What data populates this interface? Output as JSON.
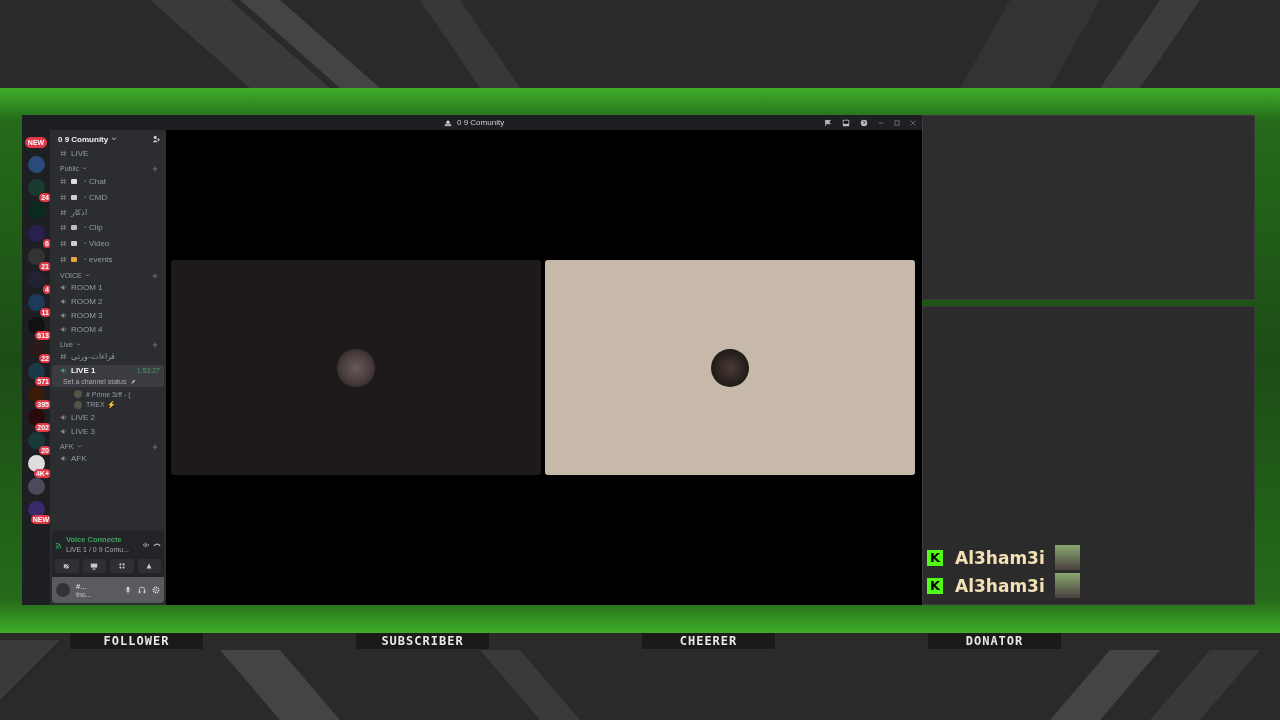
{
  "window": {
    "title": "0 9 Comunity"
  },
  "server_rail": [
    {
      "kind": "pill",
      "badge": "NEW"
    },
    {
      "kind": "server"
    },
    {
      "kind": "server",
      "badge": "24"
    },
    {
      "kind": "server"
    },
    {
      "kind": "server",
      "badge": "6"
    },
    {
      "kind": "server",
      "badge": "21"
    },
    {
      "kind": "server",
      "badge": "4"
    },
    {
      "kind": "server",
      "badge": "11"
    },
    {
      "kind": "server",
      "badge": "613"
    },
    {
      "kind": "server",
      "badge": "22"
    },
    {
      "kind": "server",
      "badge": "571"
    },
    {
      "kind": "server",
      "badge": "395"
    },
    {
      "kind": "server",
      "badge": "202"
    },
    {
      "kind": "server",
      "badge": "20"
    },
    {
      "kind": "server",
      "badge": "4K+"
    },
    {
      "kind": "server"
    },
    {
      "kind": "server",
      "badge": "NEW"
    }
  ],
  "server": {
    "name": "0 9 Comunity"
  },
  "top_channel": "LIVE",
  "categories": [
    {
      "name": "Public",
      "channels": [
        {
          "kind": "text",
          "name": "・Chat",
          "selected": false
        },
        {
          "kind": "text",
          "name": "・CMD",
          "selected": false
        },
        {
          "kind": "text",
          "name": "اذكار",
          "selected": false
        },
        {
          "kind": "text",
          "name": "・Clip",
          "selected": false
        },
        {
          "kind": "text",
          "name": "・Video",
          "selected": false
        },
        {
          "kind": "text",
          "name": "・events",
          "selected": false
        }
      ]
    },
    {
      "name": "VOICE",
      "channels": [
        {
          "kind": "voice",
          "name": "ROOM 1",
          "selected": false
        },
        {
          "kind": "voice",
          "name": "ROOM 2",
          "selected": false
        },
        {
          "kind": "voice",
          "name": "ROOM 3",
          "selected": false
        },
        {
          "kind": "voice",
          "name": "ROOM 4",
          "selected": false
        }
      ]
    },
    {
      "name": "Live",
      "channels": [
        {
          "kind": "text",
          "name": "قراءات-ورتي",
          "selected": false
        },
        {
          "kind": "voice",
          "name": "LIVE 1",
          "selected": true,
          "timer": "1:53:27",
          "status_hint": "Set a channel status",
          "members": [
            "# Prime 3rff - (",
            "TREX ⚡"
          ]
        },
        {
          "kind": "voice",
          "name": "LIVE 2",
          "selected": false
        },
        {
          "kind": "voice",
          "name": "LIVE 3",
          "selected": false
        }
      ]
    },
    {
      "name": "AFK",
      "channels": [
        {
          "kind": "voice",
          "name": "AFK",
          "selected": false
        }
      ]
    }
  ],
  "voice_panel": {
    "status": "Voice Connecte",
    "channel": "LIVE 1 / 0 9 Comu..."
  },
  "user_panel": {
    "name": "#...",
    "status": "Ino..."
  },
  "video_tiles": [
    {
      "kind": "dark"
    },
    {
      "kind": "light"
    }
  ],
  "chat": [
    {
      "mark": "K",
      "name": "Al3ham3i"
    },
    {
      "mark": "K",
      "name": "Al3ham3i"
    }
  ],
  "overlay_labels": [
    "FOLLOWER",
    "SUBSCRIBER",
    "CHEERER",
    "DONATOR"
  ]
}
